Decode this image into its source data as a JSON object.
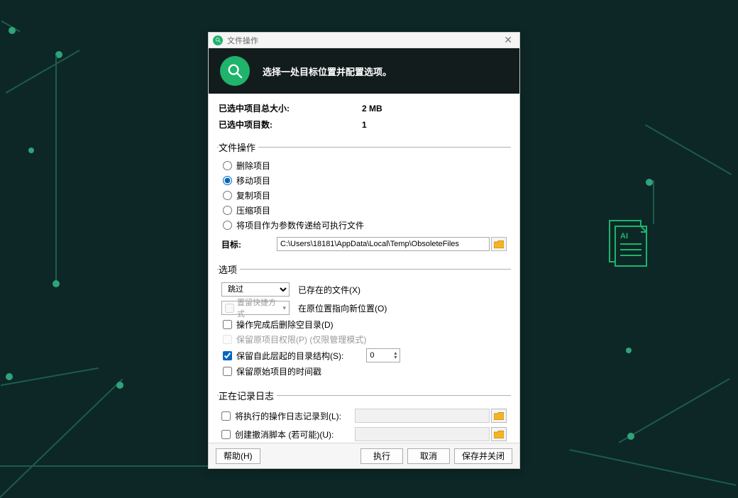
{
  "window": {
    "title": "文件操作"
  },
  "banner": {
    "heading": "选择一处目标位置并配置选项。"
  },
  "info": {
    "size_label": "已选中项目总大小:",
    "size_value": "2 MB",
    "count_label": "已选中项目数:",
    "count_value": "1"
  },
  "ops": {
    "legend": "文件操作",
    "delete": "删除项目",
    "move": "移动项目",
    "copy": "复制项目",
    "compress": "压缩项目",
    "pass_exec": "将项目作为参数传递给可执行文件",
    "target_label": "目标:",
    "target_value": "C:\\Users\\18181\\AppData\\Local\\Temp\\ObsoleteFiles"
  },
  "opts": {
    "legend": "选项",
    "skip_selected": "跳过",
    "existing_label": "已存在的文件(X)",
    "shortcut_placeholder": "置留快捷方式",
    "point_new_label": "在原位置指向新位置(O)",
    "del_empty": "操作完成后删除空目录(D)",
    "preserve_perm": "保留原项目权限(P) (仅限管理模式)",
    "preserve_depth": "保留自此层起的目录结构(S):",
    "depth_value": "0",
    "preserve_time": "保留原始项目的时间戳"
  },
  "log": {
    "legend": "正在记录日志",
    "record_label": "将执行的操作日志记录到(L):",
    "undo_label": "创建撤消脚本 (若可能)(U):"
  },
  "footer": {
    "help": "帮助(H)",
    "run": "执行",
    "cancel": "取消",
    "save_close": "保存并关闭"
  }
}
